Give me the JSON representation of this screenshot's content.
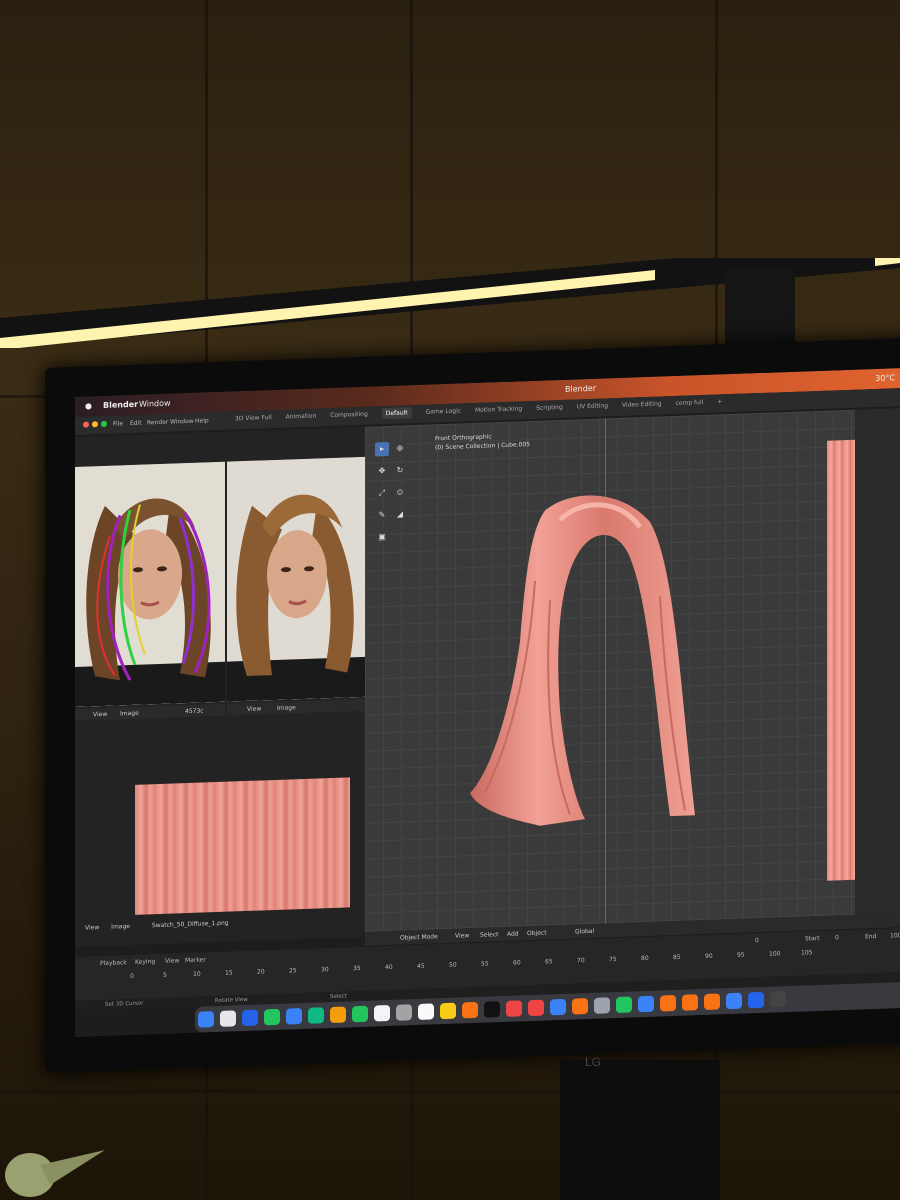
{
  "menu_bar": {
    "app": "Blender",
    "window": "Window",
    "title": "Blender",
    "temperature": "30°C"
  },
  "app_menu": [
    "File",
    "Edit",
    "Render",
    "Window",
    "Help"
  ],
  "workspace_tabs": [
    "3D View Full",
    "Animation",
    "Compositing",
    "Default",
    "Game Logic",
    "Motion Tracking",
    "Scripting",
    "UV Editing",
    "Video Editing",
    "comp full"
  ],
  "active_tab": "Default",
  "image_editor": {
    "footer_left": [
      "View",
      "Image"
    ],
    "zoom": "4573c",
    "footer_right": [
      "View",
      "Image"
    ],
    "swatch_view": "View",
    "swatch_image": "Image",
    "swatch_file": "Swatch_50_Diffuse_1.png"
  },
  "viewport": {
    "view_name": "Front Orthographic",
    "collection": "(0) Scene Collection | Cube.005",
    "mode": "Object Mode",
    "menus": [
      "View",
      "Select",
      "Add",
      "Object"
    ],
    "transform": "Global"
  },
  "timeline": {
    "menus": [
      "Playback",
      "Keying",
      "View",
      "Marker"
    ],
    "current_frame": "0",
    "start_label": "Start",
    "start": "0",
    "end_label": "End",
    "end": "100",
    "frames": [
      "0",
      "5",
      "10",
      "15",
      "20",
      "25",
      "30",
      "35",
      "40",
      "45",
      "50",
      "55",
      "60",
      "65",
      "70",
      "75",
      "80",
      "85",
      "90",
      "95",
      "100",
      "105"
    ]
  },
  "status_bar": [
    "Set 3D Cursor",
    "Rotate View",
    "Select"
  ],
  "monitor_brand": "LG",
  "colors": {
    "hair": "#e8897c",
    "viewport_grid": "#3a3a3a",
    "axis": "#3e6fc9",
    "lamp": "#fff3b0"
  }
}
